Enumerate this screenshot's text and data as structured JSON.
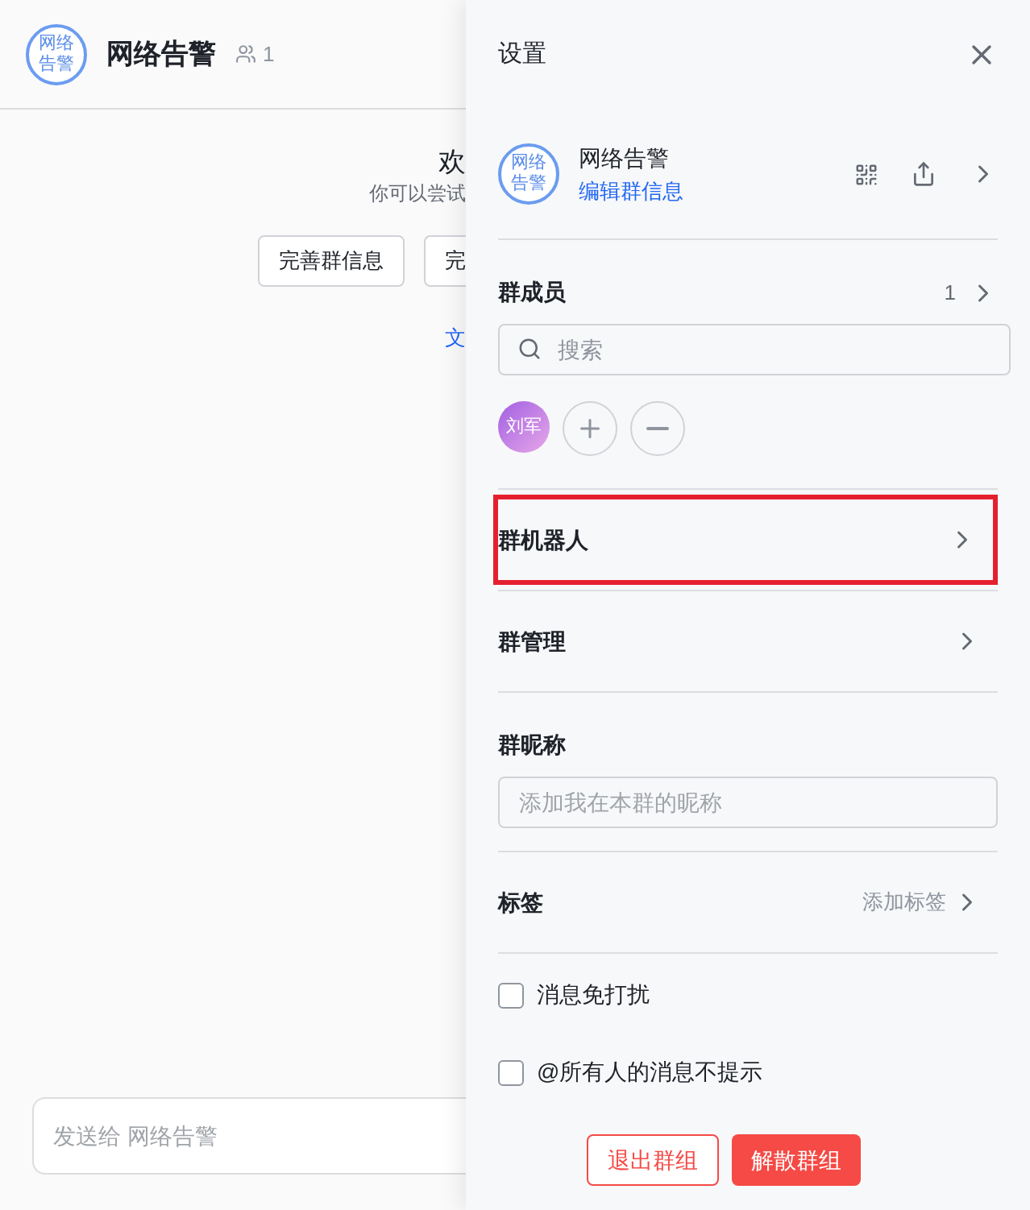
{
  "chat": {
    "avatar": "网络告警",
    "title": "网络告警",
    "member_count": "1",
    "welcome": "欢",
    "hint": "你可以尝试",
    "buttons": [
      "完善群信息",
      "完"
    ],
    "link": "文",
    "input_placeholder": "发送给 网络告警"
  },
  "drawer": {
    "title": "设置",
    "group": {
      "avatar": "网络告警",
      "name": "网络告警",
      "edit_link": "编辑群信息"
    },
    "members": {
      "label": "群成员",
      "count": "1",
      "search_placeholder": "搜索",
      "people": [
        {
          "name": "刘军"
        }
      ]
    },
    "rows": [
      {
        "label": "群机器人",
        "highlighted": true
      },
      {
        "label": "群管理",
        "highlighted": false
      }
    ],
    "nickname": {
      "label": "群昵称",
      "placeholder": "添加我在本群的昵称"
    },
    "tags": {
      "label": "标签",
      "action": "添加标签"
    },
    "options": [
      {
        "label": "消息免打扰",
        "checked": false
      },
      {
        "label": "@所有人的消息不提示",
        "checked": false
      }
    ],
    "actions": [
      {
        "label": "退出群组",
        "kind": "outline"
      },
      {
        "label": "解散群组",
        "kind": "solid"
      }
    ]
  }
}
